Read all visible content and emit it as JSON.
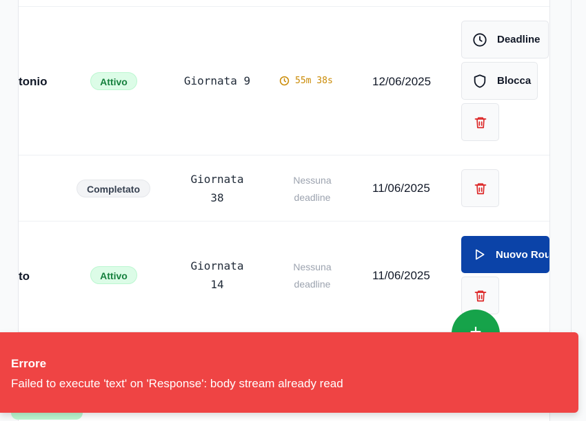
{
  "rows": [
    {
      "name": "tonio",
      "status": "Attivo",
      "round": "Giornata 9",
      "deadline": {
        "type": "timer",
        "value": "55m 38s"
      },
      "date": "12/06/2025",
      "actions": {
        "deadline_label": "Deadline",
        "block_label": "Blocca"
      }
    },
    {
      "name": "",
      "status": "Completato",
      "round_line1": "Giornata",
      "round_line2": "38",
      "deadline_line1": "Nessuna",
      "deadline_line2": "deadline",
      "date": "11/06/2025"
    },
    {
      "name": "to",
      "status": "Attivo",
      "round_line1": "Giornata",
      "round_line2": "14",
      "deadline_line1": "Nessuna",
      "deadline_line2": "deadline",
      "date": "11/06/2025",
      "actions": {
        "new_round_label": "Nuovo Round"
      }
    }
  ],
  "fab": {
    "label": "+"
  },
  "toast": {
    "title": "Errore",
    "message": "Failed to execute 'text' on 'Response': body stream already read"
  },
  "colors": {
    "toast_bg": "#ef4444",
    "primary": "#0b43a8",
    "fab": "#16a34a",
    "active_badge": "#dcfce7",
    "timer": "#ca8a04",
    "delete_icon": "#dc2626"
  },
  "icons": {
    "deadline": "clock-icon",
    "block": "shield-icon",
    "delete": "trash-icon",
    "timer": "clock-icon",
    "new_round": "play-icon"
  }
}
